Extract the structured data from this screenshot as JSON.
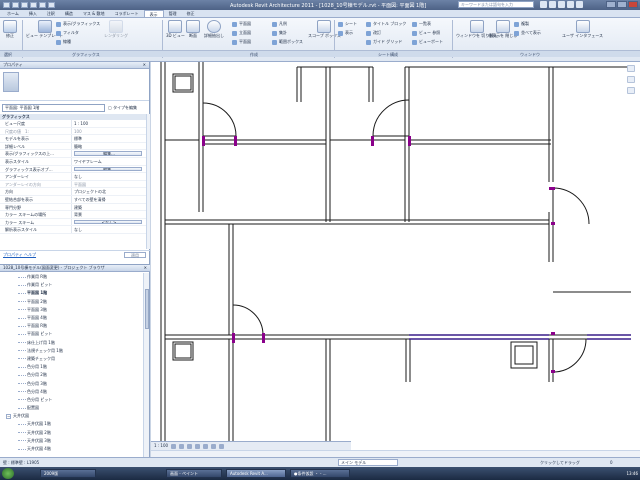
{
  "titlebar": {
    "title": "Autodesk Revit Architecture 2011 - [1028_10号棟モデル.rvt - 平面図: 平面図 1階]",
    "search_placeholder": "キーワードまたは語句を入力"
  },
  "tabs": [
    "ホーム",
    "挿入",
    "注釈",
    "構造",
    "マス & 敷地",
    "コラボレート",
    "表示",
    "管理",
    "修正"
  ],
  "active_tab_index": 6,
  "ribbon": {
    "select_label": "修正",
    "view_template_label": "ビュー テンプレート",
    "graphics_small": [
      "表示/グラフィックス",
      "フィルタ",
      "線種"
    ],
    "rendering_label": "レンダリング",
    "view3d_label": "3D ビュー",
    "section_label": "断面",
    "callout_label": "詳細抽出し",
    "create_small": [
      "平面図",
      "立面図",
      "平面図",
      "凡例",
      "集計",
      "範囲ボックス"
    ],
    "scope_box_label": "スコープ ボックス",
    "sheet_small": [
      "シート",
      "タイトル ブロック",
      "ガイド グリッド",
      "表示",
      "改訂",
      "ビューポート"
    ],
    "window_small": [
      "一覧表",
      "ビュー 参照",
      "ビューポート"
    ],
    "switch_window_label": "ウィンドウを 切り替え",
    "close_hidden_label": "非表示を 閉じる",
    "duplicate_label": "複製",
    "tile_label": "並べて表示",
    "user_interface_label": "ユーザ インタフェース",
    "panels": [
      "選択",
      "グラフィックス",
      "作成",
      "シート構成",
      "ウィンドウ"
    ]
  },
  "properties": {
    "header": "プロパティ",
    "type_selector": "平面図: 平面図 1階",
    "edit_type": "タイプを編集",
    "group": "グラフィックス",
    "rows": [
      {
        "k": "ビュー尺度",
        "v": "1 : 100",
        "dim": false,
        "btn": false
      },
      {
        "k": "尺度の値　1:",
        "v": "100",
        "dim": true,
        "btn": false
      },
      {
        "k": "モデルを表示",
        "v": "標準",
        "dim": false,
        "btn": false
      },
      {
        "k": "詳細レベル",
        "v": "簡略",
        "dim": false,
        "btn": false
      },
      {
        "k": "表示/グラフィックスの上...",
        "v": "編集...",
        "dim": false,
        "btn": true
      },
      {
        "k": "表示スタイル",
        "v": "ワイヤフレーム",
        "dim": false,
        "btn": false
      },
      {
        "k": "グラフィックス表示オプ...",
        "v": "編集...",
        "dim": false,
        "btn": true
      },
      {
        "k": "アンダーレイ",
        "v": "なし",
        "dim": false,
        "btn": false
      },
      {
        "k": "アンダーレイの方向",
        "v": "平面図",
        "dim": true,
        "btn": false
      },
      {
        "k": "方向",
        "v": "プロジェクトの北",
        "dim": false,
        "btn": false
      },
      {
        "k": "壁結合部を表示",
        "v": "すべての壁を清掃",
        "dim": false,
        "btn": false
      },
      {
        "k": "専門分野",
        "v": "建築",
        "dim": false,
        "btn": false
      },
      {
        "k": "カラー スキームの場所",
        "v": "背景",
        "dim": false,
        "btn": false
      },
      {
        "k": "カラー スキーム",
        "v": "<なし>",
        "dim": false,
        "btn": true
      },
      {
        "k": "解析表示スタイル",
        "v": "なし",
        "dim": false,
        "btn": false
      }
    ],
    "help": "プロパティ ヘルプ",
    "apply": "適用"
  },
  "browser": {
    "header": "1028_10号棟モデル(図面変更) - プロジェクト ブラウザ",
    "nodes": [
      {
        "label": "作業用 R階",
        "indent": 1,
        "bold": false,
        "exp": ""
      },
      {
        "label": "作業用 ピット",
        "indent": 1,
        "bold": false,
        "exp": ""
      },
      {
        "label": "平面図 1階",
        "indent": 1,
        "bold": true,
        "exp": ""
      },
      {
        "label": "平面図 2階",
        "indent": 1,
        "bold": false,
        "exp": ""
      },
      {
        "label": "平面図 3階",
        "indent": 1,
        "bold": false,
        "exp": ""
      },
      {
        "label": "平面図 4階",
        "indent": 1,
        "bold": false,
        "exp": ""
      },
      {
        "label": "平面図 R階",
        "indent": 1,
        "bold": false,
        "exp": ""
      },
      {
        "label": "平面図 ピット",
        "indent": 1,
        "bold": false,
        "exp": ""
      },
      {
        "label": "床仕上げ用 1階",
        "indent": 1,
        "bold": false,
        "exp": ""
      },
      {
        "label": "法規チェック用 1階",
        "indent": 1,
        "bold": false,
        "exp": ""
      },
      {
        "label": "建築チェック用",
        "indent": 1,
        "bold": false,
        "exp": ""
      },
      {
        "label": "色分用 1階",
        "indent": 1,
        "bold": false,
        "exp": ""
      },
      {
        "label": "色分用 2階",
        "indent": 1,
        "bold": false,
        "exp": ""
      },
      {
        "label": "色分用 3階",
        "indent": 1,
        "bold": false,
        "exp": ""
      },
      {
        "label": "色分用 4階",
        "indent": 1,
        "bold": false,
        "exp": ""
      },
      {
        "label": "色分用 ピット",
        "indent": 1,
        "bold": false,
        "exp": ""
      },
      {
        "label": "配置図",
        "indent": 1,
        "bold": false,
        "exp": ""
      },
      {
        "label": "天井伏図",
        "indent": 0,
        "bold": false,
        "exp": "−"
      },
      {
        "label": "天井伏図 1階",
        "indent": 1,
        "bold": false,
        "exp": ""
      },
      {
        "label": "天井伏図 2階",
        "indent": 1,
        "bold": false,
        "exp": ""
      },
      {
        "label": "天井伏図 3階",
        "indent": 1,
        "bold": false,
        "exp": ""
      },
      {
        "label": "天井伏図 4階",
        "indent": 1,
        "bold": false,
        "exp": ""
      }
    ]
  },
  "viewbar": {
    "scale": "1 : 100"
  },
  "status": {
    "message": "壁 : 標準壁 : L1905",
    "model": "メイン モデル",
    "hint": "クリックしてドラッグ",
    "filter": "0"
  },
  "taskbar": {
    "tasks": [
      "2009版",
      "画面 - ペイント",
      "Autodesk Revit A...",
      "●条件仮設 ・ - ..."
    ],
    "active_task_index": 2,
    "clock": "13:46"
  },
  "colors": {
    "accent_door": "#8a008a",
    "selected_wall": "#3a1f8a"
  }
}
